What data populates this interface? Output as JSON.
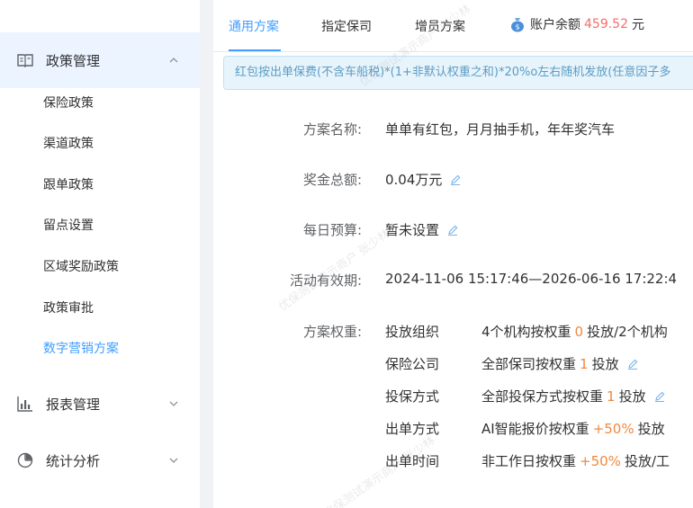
{
  "sidebar": {
    "policy_group_label": "政策管理",
    "items": [
      {
        "label": "保险政策"
      },
      {
        "label": "渠道政策"
      },
      {
        "label": "跟单政策"
      },
      {
        "label": "留点设置"
      },
      {
        "label": "区域奖励政策"
      },
      {
        "label": "政策审批"
      },
      {
        "label": "数字营销方案"
      }
    ],
    "report_group_label": "报表管理",
    "stats_group_label": "统计分析"
  },
  "tabs": [
    {
      "label": "通用方案"
    },
    {
      "label": "指定保司"
    },
    {
      "label": "增员方案"
    }
  ],
  "balance": {
    "label": "账户余额",
    "amount": "459.52",
    "unit": "元"
  },
  "notice": "红包按出单保费(不含车船税)*(1+非默认权重之和)*20%o左右随机发放(任意因子多",
  "form": {
    "name_label": "方案名称:",
    "name_value": "单单有红包，月月抽手机，年年奖汽车",
    "total_label": "奖金总额:",
    "total_value": "0.04万元",
    "daily_label": "每日预算:",
    "daily_value": "暂未设置",
    "period_label": "活动有效期:",
    "period_value": "2024-11-06 15:17:46—2026-06-16 17:22:4",
    "weight_label": "方案权重:"
  },
  "weights": [
    {
      "name": "投放组织",
      "pre": "4个机构按权重",
      "val": "0",
      "post": "投放/2个机构"
    },
    {
      "name": "保险公司",
      "pre": "全部保司按权重",
      "val": "1",
      "post": "投放"
    },
    {
      "name": "投保方式",
      "pre": "全部投保方式按权重",
      "val": "1",
      "post": "投放"
    },
    {
      "name": "出单方式",
      "pre": "AI智能报价按权重",
      "val": "+50%",
      "post": "投放"
    },
    {
      "name": "出单时间",
      "pre": "非工作日按权重",
      "val": "+50%",
      "post": "投放/工"
    }
  ],
  "watermark_text": "优保测试演示商户 张少林",
  "colors": {
    "accent": "#409eff",
    "amount": "#f56c6c",
    "weight": "#f0883e"
  }
}
